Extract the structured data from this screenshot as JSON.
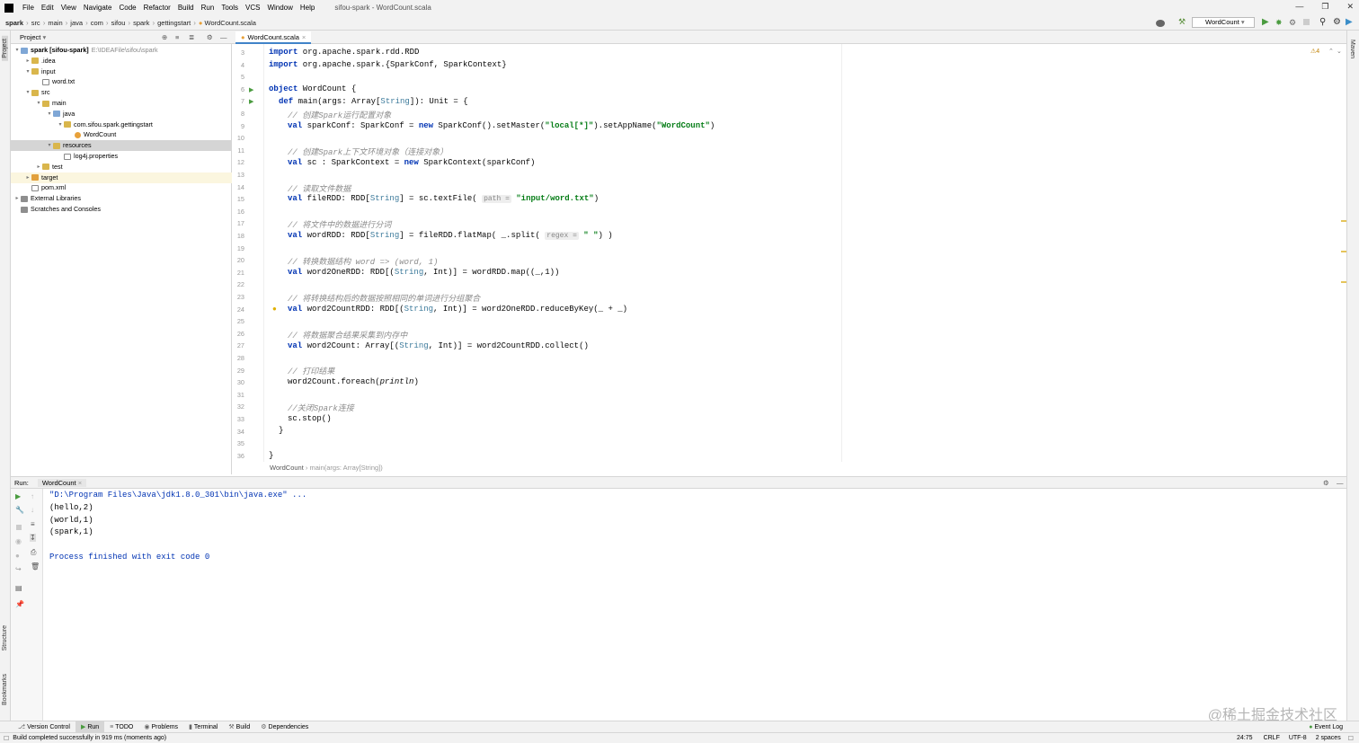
{
  "window": {
    "title": "sifou-spark - WordCount.scala"
  },
  "menu": [
    "File",
    "Edit",
    "View",
    "Navigate",
    "Code",
    "Refactor",
    "Build",
    "Run",
    "Tools",
    "VCS",
    "Window",
    "Help"
  ],
  "breadcrumb": [
    "spark",
    "src",
    "main",
    "java",
    "com",
    "sifou",
    "spark",
    "gettingstart",
    "WordCount.scala"
  ],
  "run_config": "WordCount",
  "project_panel": {
    "title": "Project",
    "tree": [
      {
        "label": "spark [sifou-spark]",
        "sub": "E:\\IDEAFile\\sifou\\spark",
        "depth": 0,
        "arrow": "▾",
        "icon": "bfolder",
        "bold": true
      },
      {
        "label": ".idea",
        "depth": 1,
        "arrow": "▸",
        "icon": "folder"
      },
      {
        "label": "input",
        "depth": 1,
        "arrow": "▾",
        "icon": "folder"
      },
      {
        "label": "word.txt",
        "depth": 2,
        "arrow": "",
        "icon": "file"
      },
      {
        "label": "src",
        "depth": 1,
        "arrow": "▾",
        "icon": "folder"
      },
      {
        "label": "main",
        "depth": 2,
        "arrow": "▾",
        "icon": "folder"
      },
      {
        "label": "java",
        "depth": 3,
        "arrow": "▾",
        "icon": "bfolder"
      },
      {
        "label": "com.sifou.spark.gettingstart",
        "depth": 4,
        "arrow": "▾",
        "icon": "folder"
      },
      {
        "label": "WordCount",
        "depth": 5,
        "arrow": "",
        "icon": "cls"
      },
      {
        "label": "resources",
        "depth": 3,
        "arrow": "▾",
        "icon": "folder",
        "selected": true
      },
      {
        "label": "log4j.properties",
        "depth": 4,
        "arrow": "",
        "icon": "file"
      },
      {
        "label": "test",
        "depth": 2,
        "arrow": "▸",
        "icon": "folder"
      },
      {
        "label": "target",
        "depth": 1,
        "arrow": "▸",
        "icon": "ofolder",
        "highlight": true
      },
      {
        "label": "pom.xml",
        "depth": 1,
        "arrow": "",
        "icon": "file"
      },
      {
        "label": "External Libraries",
        "depth": 0,
        "arrow": "▸",
        "icon": "lib"
      },
      {
        "label": "Scratches and Consoles",
        "depth": 0,
        "arrow": "",
        "icon": "lib"
      }
    ]
  },
  "editor": {
    "tab": "WordCount.scala",
    "warnings": "⚠4",
    "line_numbers": [
      "3",
      "4",
      "5",
      "6",
      "7",
      "8",
      "9",
      "10",
      "11",
      "12",
      "13",
      "14",
      "15",
      "16",
      "17",
      "18",
      "19",
      "20",
      "21",
      "22",
      "23",
      "24",
      "25",
      "26",
      "27",
      "28",
      "29",
      "30",
      "31",
      "32",
      "33",
      "34",
      "35",
      "36"
    ],
    "footer_crumb": "WordCount",
    "footer_crumb_sub": "main(args: Array[String])"
  },
  "code": {
    "l3_kw": "import",
    "l3": " org.apache.spark.rdd.RDD",
    "l4_kw": "import",
    "l4": " org.apache.spark.{SparkConf, SparkContext}",
    "l6_kw": "object",
    "l6": " WordCount {",
    "l7_kw": "def",
    "l7a": " main(args: Array[",
    "l7_ty": "String",
    "l7b": "]): Unit = {",
    "l8": "// 创建Spark运行配置对象",
    "l9_kw": "val",
    "l9a": " sparkConf: SparkConf = ",
    "l9_kw2": "new",
    "l9b": " SparkConf().setMaster(",
    "l9_s1": "\"local[*]\"",
    "l9c": ").setAppName(",
    "l9_s2": "\"WordCount\"",
    "l9d": ")",
    "l11": "// 创建Spark上下文环境对象（连接对象）",
    "l12_kw": "val",
    "l12a": " sc : SparkContext = ",
    "l12_kw2": "new",
    "l12b": " SparkContext(sparkConf)",
    "l14": "// 读取文件数据",
    "l15_kw": "val",
    "l15a": " fileRDD: RDD[",
    "l15_ty": "String",
    "l15b": "] = sc.textFile( ",
    "l15_hint": "path =",
    "l15_s": " \"input/word.txt\"",
    "l15c": ")",
    "l17": "// 将文件中的数据进行分词",
    "l18_kw": "val",
    "l18a": " wordRDD: RDD[",
    "l18_ty": "String",
    "l18b": "] = fileRDD.flatMap( _.split( ",
    "l18_hint": "regex =",
    "l18_s": " \" \"",
    "l18c": ") )",
    "l20": "// 转换数据结构 word => (word, 1)",
    "l21_kw": "val",
    "l21a": " word2OneRDD: RDD[(",
    "l21_ty": "String",
    "l21b": ", Int)] = wordRDD.map((_,1))",
    "l23": "// 将转换结构后的数据按照相同的单词进行分组聚合",
    "l24_kw": "val",
    "l24a": " word2CountRDD: RDD[(",
    "l24_ty": "String",
    "l24b": ", Int)] = word2OneRDD.reduceByKey(_ + _)",
    "l26": "// 将数据聚合结果采集到内存中",
    "l27_kw": "val",
    "l27a": " word2Count: Array[(",
    "l27_ty": "String",
    "l27b": ", Int)] = word2CountRDD.collect()",
    "l29": "// 打印结果",
    "l30a": "word2Count.foreach(",
    "l30_it": "println",
    "l30b": ")",
    "l32": "//关闭Spark连接",
    "l33": "sc.stop()",
    "l34": "}",
    "l36": "}"
  },
  "run_panel": {
    "label": "Run:",
    "tab": "WordCount",
    "output": {
      "cmd": "\"D:\\Program Files\\Java\\jdk1.8.0_301\\bin\\java.exe\" ...",
      "line1": "(hello,2)",
      "line2": "(world,1)",
      "line3": "(spark,1)",
      "done": "Process finished with exit code 0"
    }
  },
  "left_strip": {
    "project": "Project",
    "structure": "Structure",
    "bookmarks": "Bookmarks"
  },
  "right_strip": {
    "maven": "Maven"
  },
  "tool_windows": [
    "Version Control",
    "Run",
    "TODO",
    "Problems",
    "Terminal",
    "Build",
    "Dependencies"
  ],
  "event_log": "Event Log",
  "status": {
    "message": "Build completed successfully in 919 ms (moments ago)",
    "position": "24:75",
    "line_sep": "CRLF",
    "encoding": "UTF-8",
    "indent": "2 spaces"
  },
  "watermark": "@稀土掘金技术社区",
  "colors": {
    "keyword": "#0033b3",
    "string": "#067d17",
    "comment": "#8c8c8c",
    "type": "#3c7a9b",
    "accent": "#4083c9"
  }
}
